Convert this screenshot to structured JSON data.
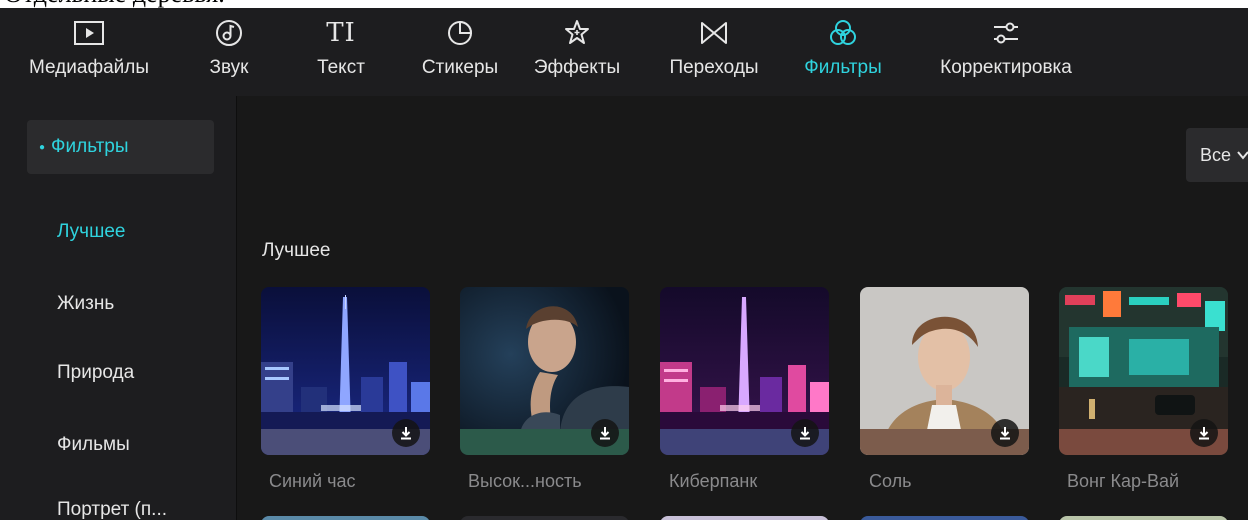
{
  "page_top_text": "Отдельные деревья.",
  "toolbar": {
    "items": [
      {
        "label": "Медиафайлы",
        "icon": "media-play-icon"
      },
      {
        "label": "Звук",
        "icon": "audio-disc-icon"
      },
      {
        "label": "Текст",
        "icon": "text-TI-icon"
      },
      {
        "label": "Стикеры",
        "icon": "sticker-icon"
      },
      {
        "label": "Эффекты",
        "icon": "effects-star-icon"
      },
      {
        "label": "Переходы",
        "icon": "transition-bowtie-icon"
      },
      {
        "label": "Фильтры",
        "icon": "filters-circles-icon",
        "active": true
      },
      {
        "label": "Корректировка",
        "icon": "adjust-sliders-icon"
      }
    ],
    "text_icon_glyph": "TI"
  },
  "sidebar": {
    "group_label": "Фильтры",
    "items": [
      {
        "label": "Лучшее",
        "active": true
      },
      {
        "label": "Жизнь"
      },
      {
        "label": "Природа"
      },
      {
        "label": "Фильмы"
      },
      {
        "label": "Портрет (п..."
      }
    ]
  },
  "main": {
    "dropdown_value": "Все",
    "section_title": "Лучшее",
    "cards": [
      {
        "label": "Синий час",
        "band_color": "#4b4e78"
      },
      {
        "label": "Высок...ность",
        "band_color": "#2c5a4a"
      },
      {
        "label": "Киберпанк",
        "band_color": "#3f4378"
      },
      {
        "label": "Соль",
        "band_color": "#7c5c4c"
      },
      {
        "label": "Вонг Кар-Вай",
        "band_color": "#7a4a3e"
      }
    ]
  },
  "colors": {
    "accent": "#2fd3de",
    "app_background": "#181818",
    "panel_background": "#1d1d1f"
  }
}
